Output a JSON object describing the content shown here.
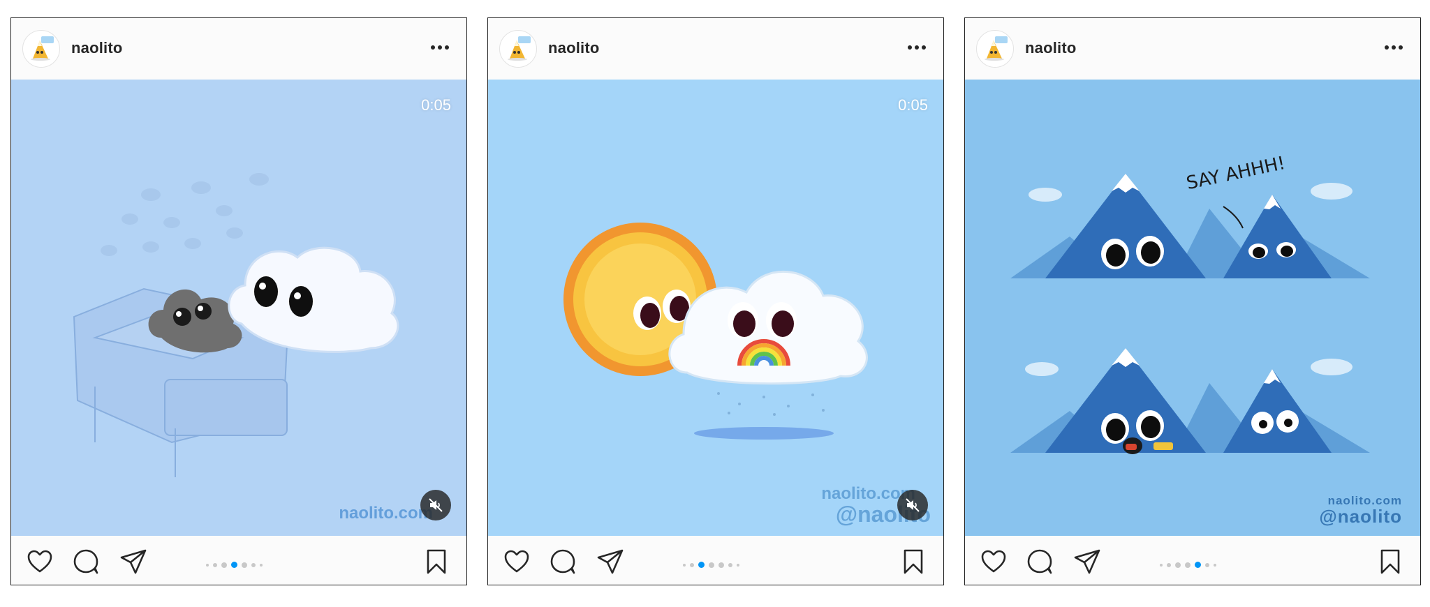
{
  "posts": [
    {
      "username": "naolito",
      "video_timer": "0:05",
      "watermark_site": "naolito.com",
      "watermark_handle": "",
      "avatar_icon": "naolito-mountain-avatar",
      "carousel": {
        "count": 7,
        "active": 3
      },
      "actions": [
        "like-icon",
        "comment-icon",
        "share-icon",
        "save-icon"
      ],
      "muted": true
    },
    {
      "username": "naolito",
      "video_timer": "0:05",
      "watermark_site": "naolito.com",
      "watermark_handle": "@naolito",
      "avatar_icon": "naolito-mountain-avatar",
      "carousel": {
        "count": 7,
        "active": 2
      },
      "actions": [
        "like-icon",
        "comment-icon",
        "share-icon",
        "save-icon"
      ],
      "muted": true
    },
    {
      "username": "naolito",
      "video_timer": "",
      "comic_text": "SAY AHHH!",
      "watermark_site": "naolito.com",
      "watermark_handle": "@naolito",
      "avatar_icon": "naolito-mountain-avatar",
      "carousel": {
        "count": 7,
        "active": 5
      },
      "actions": [
        "like-icon",
        "comment-icon",
        "share-icon",
        "save-icon"
      ],
      "muted": false
    }
  ],
  "colors": {
    "link_blue": "#0095f6",
    "dot_inactive": "#c8c8c8",
    "text": "#262626",
    "media_bg_1": "#b3d3f5",
    "media_bg_2": "#a4d5f9",
    "media_bg_3": "#89c3ee"
  }
}
